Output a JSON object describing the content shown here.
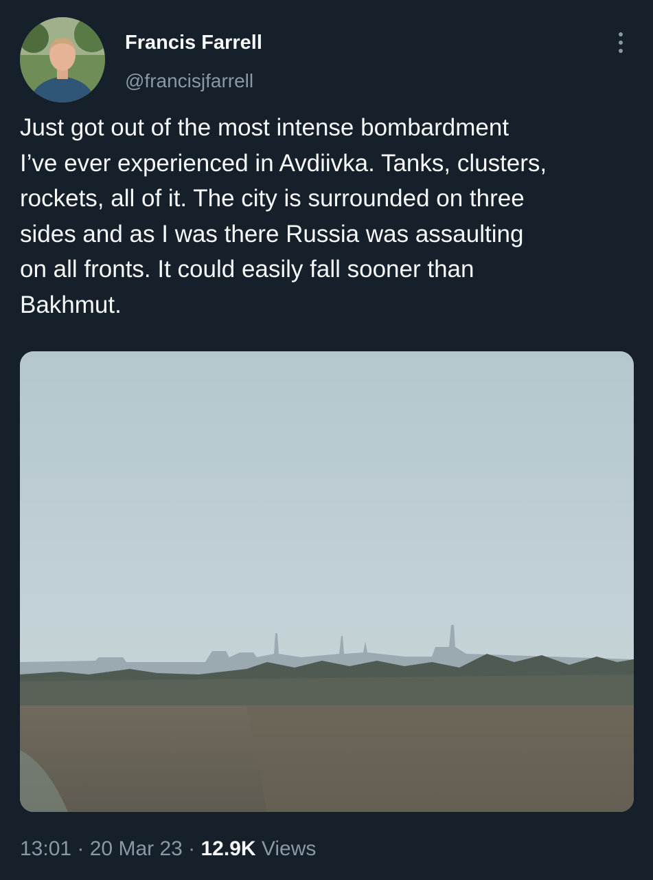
{
  "author": {
    "display_name": "Francis Farrell",
    "handle": "@francisjfarrell"
  },
  "tweet": {
    "text": "Just got out of the most intense bombardment\nI’ve ever experienced in Avdiivka. Tanks, clusters,\nrockets, all of it. The city is surrounded on three\nsides and as I was there Russia was assaulting\non all fronts. It could easily fall sooner than\nBakhmut."
  },
  "meta": {
    "time": "13:01",
    "separator": " · ",
    "date": "20 Mar 23",
    "views_count": "12.9K",
    "views_label": " Views"
  },
  "icons": {
    "more": "more-vertical-icon"
  },
  "colors": {
    "background": "#15202b",
    "primary_text": "#f7f9f9",
    "secondary_text": "#8b98a5"
  }
}
